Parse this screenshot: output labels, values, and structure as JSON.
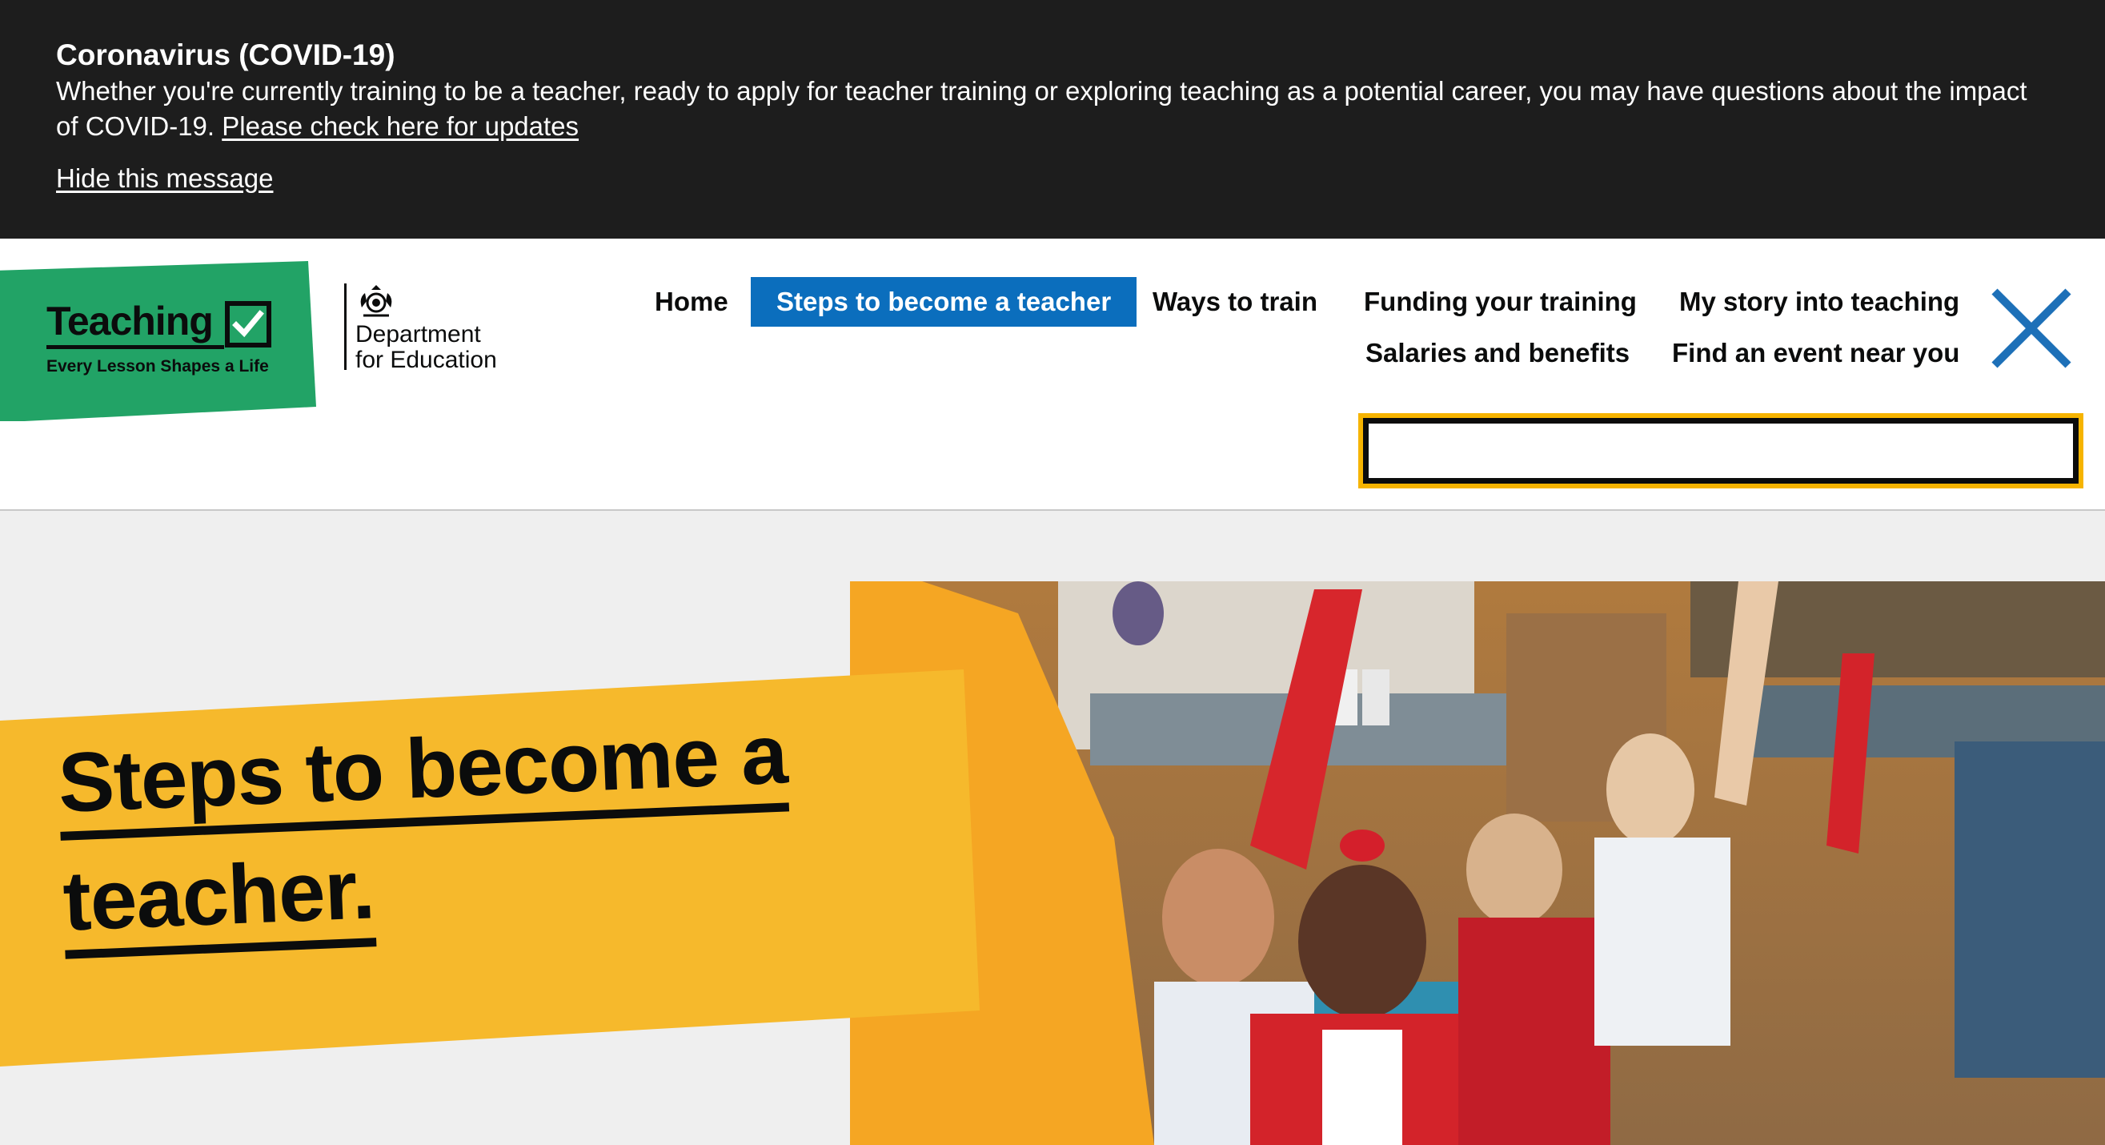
{
  "banner": {
    "title": "Coronavirus (COVID-19)",
    "text": "Whether you're currently training to be a teacher, ready to apply for teacher training or exploring teaching as a potential career, you may have questions about the impact of COVID-19.",
    "link": "Please check here for updates",
    "hide": "Hide this message"
  },
  "logo": {
    "word": "Teaching",
    "tagline": "Every Lesson Shapes a Life",
    "dfe_line1": "Department",
    "dfe_line2": "for Education"
  },
  "nav": {
    "home": "Home",
    "steps": "Steps to become a teacher",
    "ways": "Ways to train",
    "funding": "Funding your training",
    "story": "My story into teaching",
    "salaries": "Salaries and benefits",
    "events": "Find an event near you"
  },
  "search": {
    "value": "",
    "placeholder": ""
  },
  "hero": {
    "title_line1": "Steps to become a",
    "title_line2": "teacher."
  },
  "colors": {
    "banner_bg": "#1d1d1d",
    "brand_green": "#22a366",
    "active_blue": "#0b6ebd",
    "hero_yellow": "#f6b92c",
    "focus_yellow": "#f6b400"
  },
  "icons": [
    "checkmark-icon",
    "royal-crest-icon",
    "close-icon"
  ]
}
